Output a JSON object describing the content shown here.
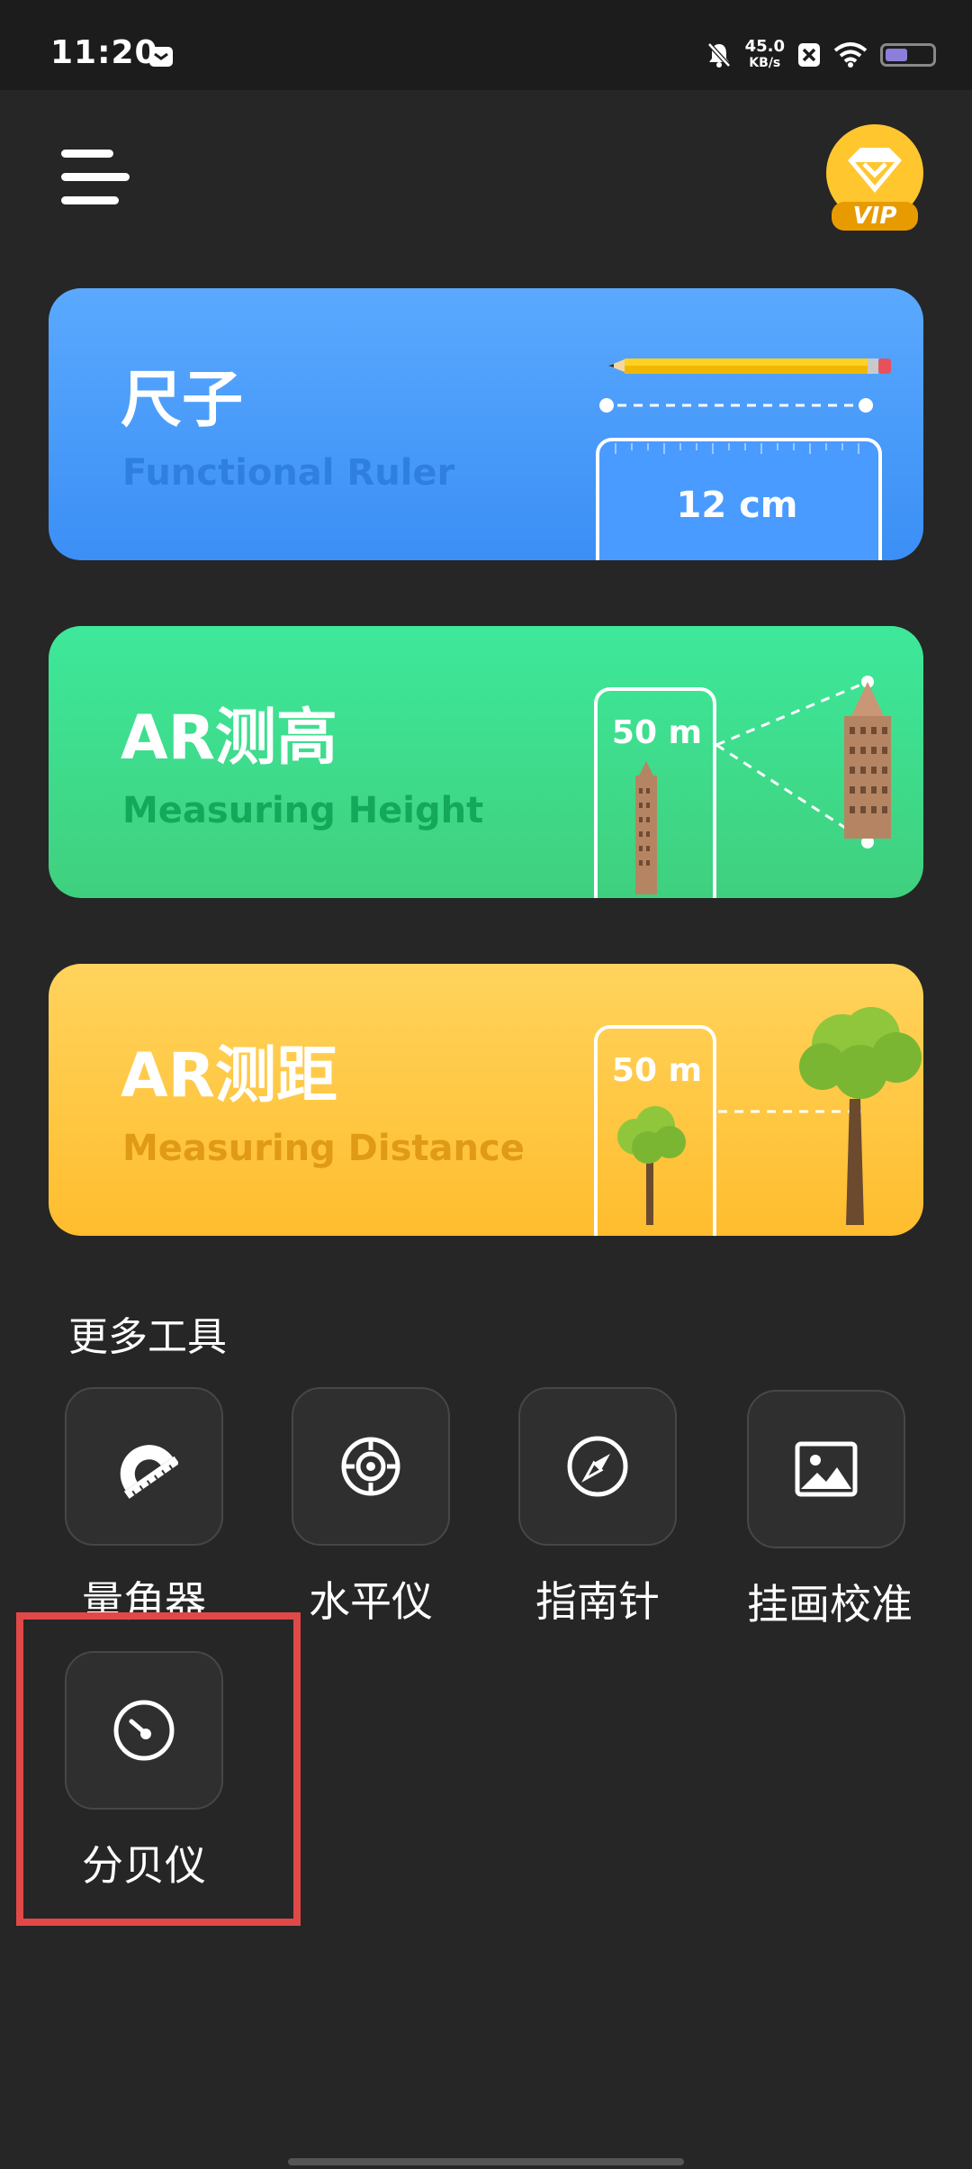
{
  "status_bar": {
    "time": "11:20",
    "net_speed_value": "45.0",
    "net_speed_unit": "KB/s"
  },
  "header": {
    "vip_label": "VIP"
  },
  "cards": [
    {
      "title": "尺子",
      "subtitle": "Functional Ruler",
      "art_label": "12 cm"
    },
    {
      "title": "AR测高",
      "subtitle": "Measuring Height",
      "art_label": "50 m"
    },
    {
      "title": "AR测距",
      "subtitle": "Measuring Distance",
      "art_label": "50 m"
    }
  ],
  "more_tools": {
    "title": "更多工具",
    "items": [
      {
        "label": "量角器",
        "icon": "protractor-icon"
      },
      {
        "label": "水平仪",
        "icon": "level-crosshair-icon"
      },
      {
        "label": "指南针",
        "icon": "compass-icon"
      },
      {
        "label": "挂画校准",
        "icon": "picture-icon"
      },
      {
        "label": "分贝仪",
        "icon": "decibel-gauge-icon"
      }
    ]
  },
  "colors": {
    "ruler_card": "#3b8ff5",
    "height_card": "#3fd07e",
    "distance_card": "#ffbd2e",
    "highlight": "#e14848"
  }
}
